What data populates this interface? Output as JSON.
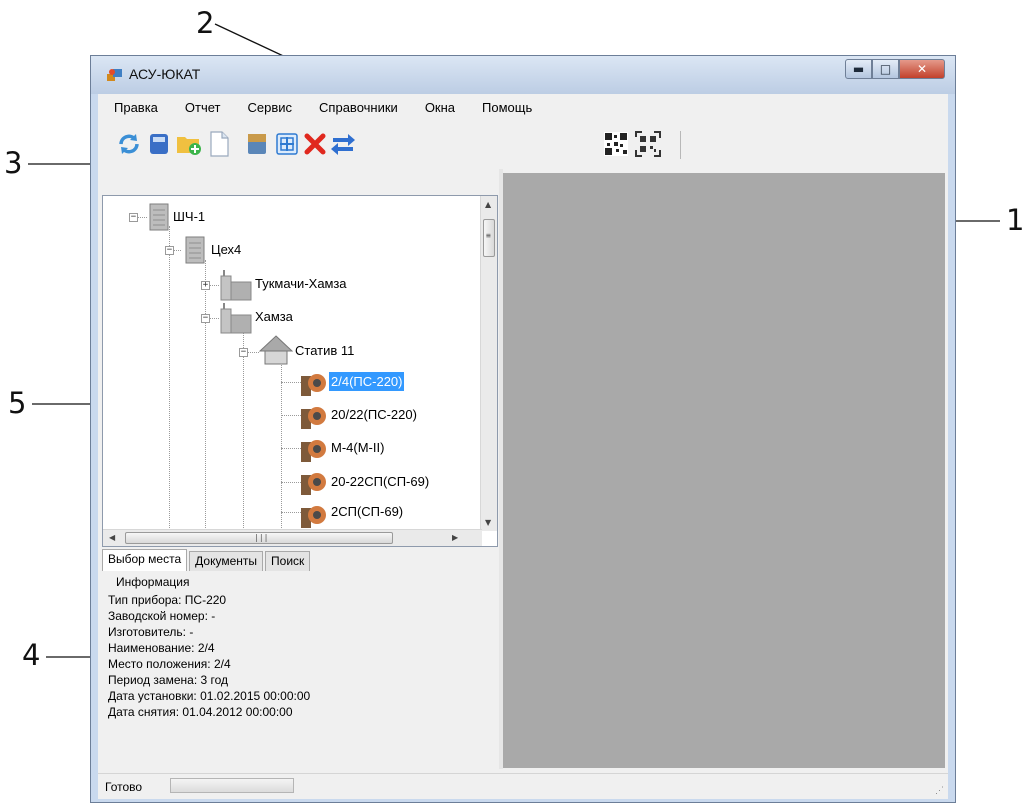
{
  "window": {
    "title": "АСУ-ЮКАТ"
  },
  "menu": {
    "items": [
      "Правка",
      "Отчет",
      "Сервис",
      "Справочники",
      "Окна",
      "Помощь"
    ]
  },
  "toolbar": {
    "buttons": [
      "refresh-icon",
      "calculator-icon",
      "add-folder-icon",
      "new-document-icon",
      "archive-icon",
      "grid-icon",
      "delete-icon",
      "swap-icon",
      "qr-code-icon",
      "qr-scan-icon"
    ]
  },
  "tree": {
    "nodes": [
      "ШЧ-1",
      "Цех4",
      "Тукмачи-Хамза",
      "Хамза",
      "Статив 11",
      "2/4(ПС-220)",
      "20/22(ПС-220)",
      "М-4(М-II)",
      "20-22СП(СП-69)",
      "2СП(СП-69)"
    ],
    "selected": "2/4(ПС-220)"
  },
  "tabs": [
    "Выбор места",
    "Документы",
    "Поиск"
  ],
  "info": {
    "title": "Информация",
    "lines": [
      "Тип прибора: ПС-220",
      "Заводской номер: -",
      "Изготовитель: -",
      "Наименование: 2/4",
      "Место положения: 2/4",
      "Период замена: 3 год",
      "Дата установки: 01.02.2015 00:00:00",
      "Дата снятия: 01.04.2012 00:00:00"
    ]
  },
  "status": {
    "text": "Готово"
  },
  "callouts": [
    "1",
    "2",
    "3",
    "4",
    "5"
  ]
}
